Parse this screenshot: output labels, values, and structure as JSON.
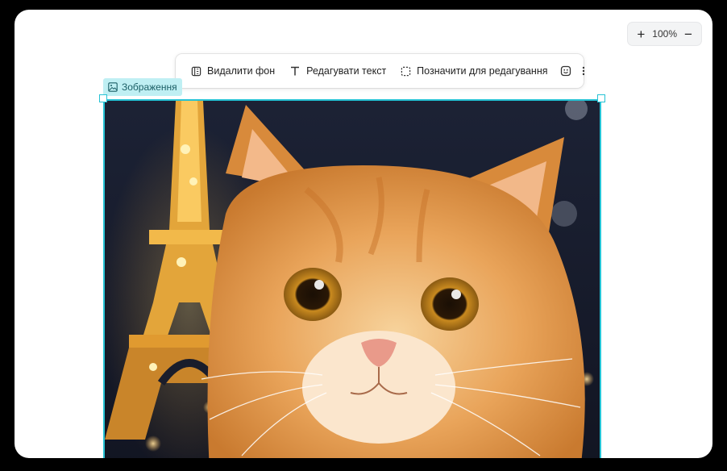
{
  "zoom": {
    "plus_label": "+",
    "minus_label": "−",
    "level": "100%"
  },
  "toolbar": {
    "remove_bg_label": "Видалити фон",
    "edit_text_label": "Редагувати текст",
    "mark_for_edit_label": "Позначити для редагування",
    "emoji_icon": "smile-icon",
    "more_icon": "more-vertical-icon"
  },
  "selection": {
    "label": "Зображення",
    "accent_color": "#25c2d4"
  },
  "image": {
    "subject": "orange-cat-eiffel-tower-night"
  }
}
